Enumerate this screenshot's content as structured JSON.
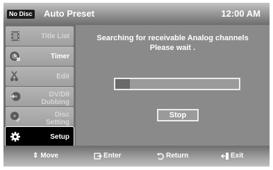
{
  "header": {
    "disc_status": "No Disc",
    "title": "Auto Preset",
    "clock": "12:00 AM"
  },
  "sidebar": {
    "items": [
      {
        "label": "Title List",
        "icon": "film-strip-icon",
        "enabled": false,
        "active": false
      },
      {
        "label": "Timer",
        "icon": "clock-icon",
        "enabled": true,
        "active": false
      },
      {
        "label": "Edit",
        "icon": "scissors-icon",
        "enabled": false,
        "active": false
      },
      {
        "label": "DV/D8 Dubbing",
        "icon": "dubbing-icon",
        "enabled": false,
        "active": false
      },
      {
        "label": "Disc Setting",
        "icon": "disc-setting-icon",
        "enabled": false,
        "active": false
      },
      {
        "label": "Setup",
        "icon": "gear-icon",
        "enabled": true,
        "active": true
      }
    ]
  },
  "main": {
    "message_line1": "Searching for receivable Analog channels",
    "message_line2": "Please wait .",
    "progress_fraction": 0.12,
    "stop_label": "Stop"
  },
  "footer": {
    "hints": [
      {
        "icon": "up-down-arrows-icon",
        "label": "Move"
      },
      {
        "icon": "enter-icon",
        "label": "Enter"
      },
      {
        "icon": "return-icon",
        "label": "Return"
      },
      {
        "icon": "exit-icon",
        "label": "Exit"
      }
    ]
  }
}
